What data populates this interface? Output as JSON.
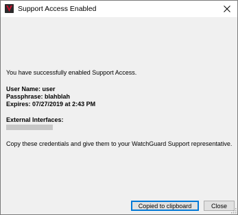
{
  "window": {
    "title": "Support Access Enabled",
    "icon": "watchguard-app-icon",
    "close_icon": "close-icon"
  },
  "message": {
    "success": "You have successfully enabled Support Access."
  },
  "credentials": {
    "username_label": "User Name: user",
    "passphrase_label": "Passphrase: blahblah",
    "expires_label": "Expires: 07/27/2019 at 2:43 PM"
  },
  "external_interfaces": {
    "label": "External Interfaces:"
  },
  "instructions": "Copy these credentials and give them to your WatchGuard Support representative.",
  "buttons": {
    "copy": "Copied to clipboard",
    "close": "Close"
  },
  "colors": {
    "window_bg": "#f0f0f0",
    "titlebar_bg": "#ffffff",
    "focus_border": "#0078d7",
    "redaction": "#c7c7c7"
  }
}
